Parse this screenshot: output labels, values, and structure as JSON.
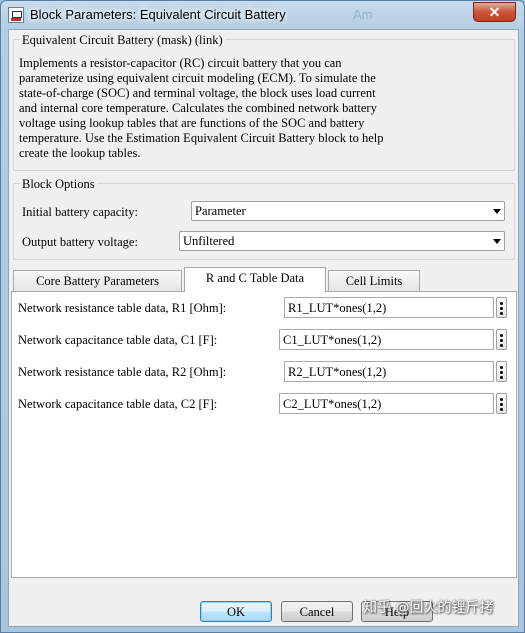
{
  "window": {
    "title": "Block Parameters: Equivalent Circuit Battery",
    "background_word": "Am"
  },
  "description": {
    "heading": "Equivalent Circuit Battery (mask) (link)",
    "text": "Implements a resistor-capacitor (RC) circuit battery that you can\nparameterize using equivalent circuit modeling (ECM).  To simulate the\nstate-of-charge (SOC) and terminal voltage, the block uses load current\nand internal core temperature. Calculates the combined network battery\nvoltage using lookup tables that are functions of the SOC and battery\ntemperature. Use the Estimation Equivalent Circuit Battery block to help\ncreate the lookup tables."
  },
  "block_options": {
    "heading": "Block Options",
    "capacity": {
      "label": "Initial battery capacity:",
      "value": "Parameter"
    },
    "voltage": {
      "label": "Output battery voltage:",
      "value": "Unfiltered"
    }
  },
  "tabs": [
    {
      "label": "Core Battery Parameters"
    },
    {
      "label": "R and C Table Data"
    },
    {
      "label": "Cell Limits"
    }
  ],
  "params": [
    {
      "label": "Network resistance table data, R1 [Ohm]:",
      "value": "R1_LUT*ones(1,2)"
    },
    {
      "label": "Network capacitance table data, C1 [F]:",
      "value": "C1_LUT*ones(1,2)"
    },
    {
      "label": "Network resistance table data, R2 [Ohm]:",
      "value": "R2_LUT*ones(1,2)"
    },
    {
      "label": "Network capacitance table data, C2 [F]:",
      "value": "C2_LUT*ones(1,2)"
    }
  ],
  "buttons": {
    "ok": "OK",
    "cancel": "Cancel",
    "help": "Help"
  },
  "watermark": "知乎 @回火的锂斤拷",
  "colors": {
    "close": "#c23b22",
    "active_tab": "#ffffff",
    "dialog_bg": "#f0f0f0"
  }
}
